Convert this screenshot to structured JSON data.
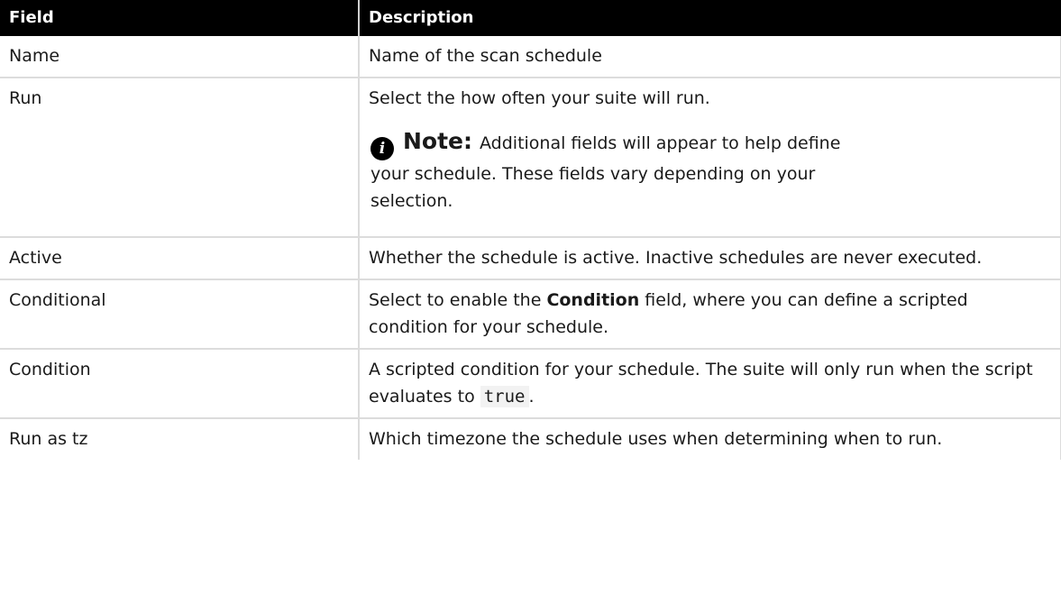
{
  "table": {
    "headers": {
      "field": "Field",
      "description": "Description"
    },
    "rows": [
      {
        "field": "Name",
        "description": "Name of the scan schedule"
      },
      {
        "field": "Run",
        "description": "Select the how often your suite will run.",
        "note": {
          "label": "Note:",
          "text": "Additional fields will appear to help define your schedule. These fields vary depending on your selection.",
          "icon": "info-icon"
        }
      },
      {
        "field": "Active",
        "description": "Whether the schedule is active. Inactive schedules are never executed."
      },
      {
        "field": "Conditional",
        "description_before": "Select to enable the ",
        "description_bold": "Condition",
        "description_after": " field, where you can define a scripted condition for your schedule."
      },
      {
        "field": "Condition",
        "description_before": "A scripted condition for your schedule. The suite will only run when the script evaluates to ",
        "description_code": "true",
        "description_after": "."
      },
      {
        "field": "Run as tz",
        "description": "Which timezone the schedule uses when determining when to run."
      }
    ]
  },
  "colors": {
    "header_bg": "#000000",
    "header_text": "#ffffff",
    "border": "#dcdcdc",
    "code_bg": "#f2f2f2"
  }
}
